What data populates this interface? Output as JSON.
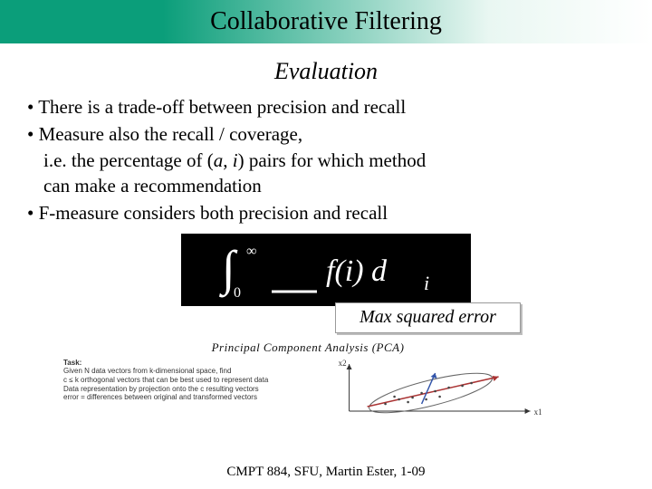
{
  "header": {
    "title": "Collaborative Filtering"
  },
  "subtitle": "Evaluation",
  "bullets": {
    "b1": "There is a trade-off between precision and recall",
    "b2": "Measure also the recall / coverage,",
    "b2_line2_prefix": "i.e. the percentage of (",
    "b2_var_a": "a",
    "b2_comma": ", ",
    "b2_var_i": "i",
    "b2_line2_suffix": ") pairs for which method",
    "b2_line3": "can make a recommendation",
    "b3": "F-measure considers both precision and recall"
  },
  "formula": {
    "int_sign": "∫",
    "lower": "0",
    "upper": "∞",
    "body": "f(i) d",
    "sub": "i"
  },
  "mse_label": "Max squared error",
  "pca": {
    "title": "Principal Component Analysis (PCA)",
    "task_hd": "Task:",
    "task_l1": "Given N data vectors from k-dimensional space, find",
    "task_l2": "c ≤ k orthogonal vectors that can be best used to represent data",
    "task_l3": "Data representation by projection onto the c resulting vectors",
    "task_l4": "error = differences between original and transformed vectors",
    "x1": "x1",
    "x2": "x2"
  },
  "footer": "CMPT 884, SFU, Martin Ester, 1-09"
}
